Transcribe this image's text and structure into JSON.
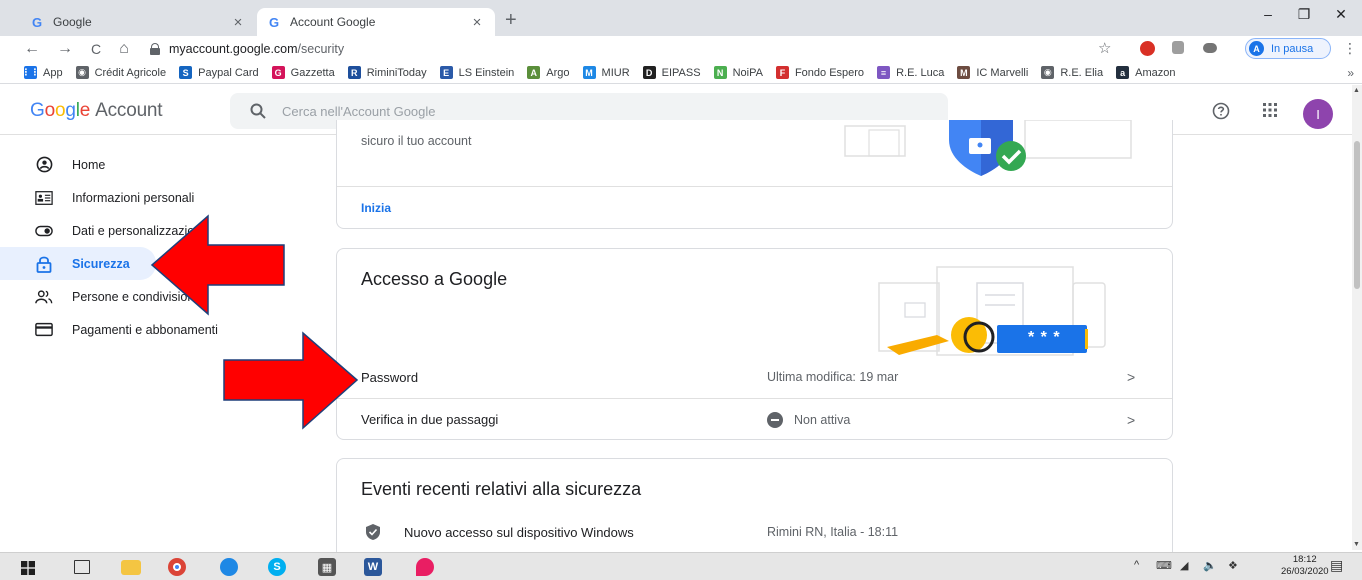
{
  "browser": {
    "tabs": [
      {
        "label": "Google",
        "close": "×"
      },
      {
        "label": "Account Google",
        "close": "×"
      }
    ],
    "new_tab": "+",
    "window_controls": {
      "minimize": "–",
      "restore": "❐",
      "close": "✕"
    },
    "nav": {
      "back": "←",
      "forward": "→",
      "reload": "C",
      "home": "⌂"
    },
    "url_host": "myaccount.google.com",
    "url_path": "/security",
    "profile_initial": "A",
    "profile_status": "In pausa",
    "menu": "⋮",
    "bookmarks": [
      {
        "label": "App",
        "icon": "apps-grid-icon",
        "color": "#1a73e8",
        "glyph": "⋮⋮"
      },
      {
        "label": "Crédit Agricole",
        "icon": "globe-icon",
        "color": "#5f6368",
        "glyph": "◉"
      },
      {
        "label": "Paypal Card",
        "icon": "s-logo-icon",
        "color": "#1565c0",
        "glyph": "S"
      },
      {
        "label": "Gazzetta",
        "icon": "gazzetta-icon",
        "color": "#d4145a",
        "glyph": "G"
      },
      {
        "label": "RiminiToday",
        "icon": "r-logo-icon",
        "color": "#1e4f9c",
        "glyph": "R"
      },
      {
        "label": "LS Einstein",
        "icon": "einstein-icon",
        "color": "#2b5aa8",
        "glyph": "E"
      },
      {
        "label": "Argo",
        "icon": "argo-icon",
        "color": "#5b8f3b",
        "glyph": "A"
      },
      {
        "label": "MIUR",
        "icon": "miur-icon",
        "color": "#1e88e5",
        "glyph": "M"
      },
      {
        "label": "EIPASS",
        "icon": "eipass-icon",
        "color": "#212121",
        "glyph": "D"
      },
      {
        "label": "NoiPA",
        "icon": "noipa-icon",
        "color": "#4caf50",
        "glyph": "N"
      },
      {
        "label": "Fondo Espero",
        "icon": "espero-icon",
        "color": "#d32f2f",
        "glyph": "F"
      },
      {
        "label": "R.E. Luca",
        "icon": "re-luca-icon",
        "color": "#7e57c2",
        "glyph": "≡"
      },
      {
        "label": "IC Marvelli",
        "icon": "marvelli-icon",
        "color": "#6d4c41",
        "glyph": "M"
      },
      {
        "label": "R.E. Elia",
        "icon": "globe-icon",
        "color": "#5f6368",
        "glyph": "◉"
      },
      {
        "label": "Amazon",
        "icon": "amazon-icon",
        "color": "#232f3e",
        "glyph": "a"
      }
    ],
    "bookmarks_more": "»"
  },
  "header": {
    "logo_letters": [
      "G",
      "o",
      "o",
      "g",
      "l",
      "e"
    ],
    "logo_suffix": "Account",
    "search_placeholder": "Cerca nell'Account Google",
    "user_initial": "I"
  },
  "colors": {
    "accent": "#1a73e8",
    "active_bg": "#e8f0fe",
    "annotation_arrow": "#ff0000",
    "avatar": "#8e44ad"
  },
  "sidenav": {
    "items": [
      {
        "label": "Home",
        "icon": "home-circle-icon",
        "active": false
      },
      {
        "label": "Informazioni personali",
        "icon": "id-card-icon",
        "active": false
      },
      {
        "label": "Dati e personalizzazione",
        "icon": "toggle-icon",
        "active": false
      },
      {
        "label": "Sicurezza",
        "icon": "lock-icon",
        "active": true
      },
      {
        "label": "Persone e condivisione",
        "icon": "people-icon",
        "active": false
      },
      {
        "label": "Pagamenti e abbonamenti",
        "icon": "credit-card-icon",
        "active": false
      }
    ]
  },
  "cards": {
    "top": {
      "description": "sicuro il tuo account",
      "link": "Inizia"
    },
    "access": {
      "title": "Accesso a Google",
      "rows": [
        {
          "label": "Password",
          "value": "Ultima modifica: 19 mar",
          "chevron": ">"
        },
        {
          "label": "Verifica in due passaggi",
          "value": "Non attiva",
          "chevron": ">"
        }
      ],
      "password_mask": "* * *"
    },
    "events": {
      "title": "Eventi recenti relativi alla sicurezza",
      "items": [
        {
          "label": "Nuovo accesso sul dispositivo Windows",
          "location": "Rimini RN, Italia - 18:11"
        }
      ]
    }
  },
  "taskbar": {
    "tray_text": "^",
    "time": "18:12",
    "date": "26/03/2020"
  }
}
